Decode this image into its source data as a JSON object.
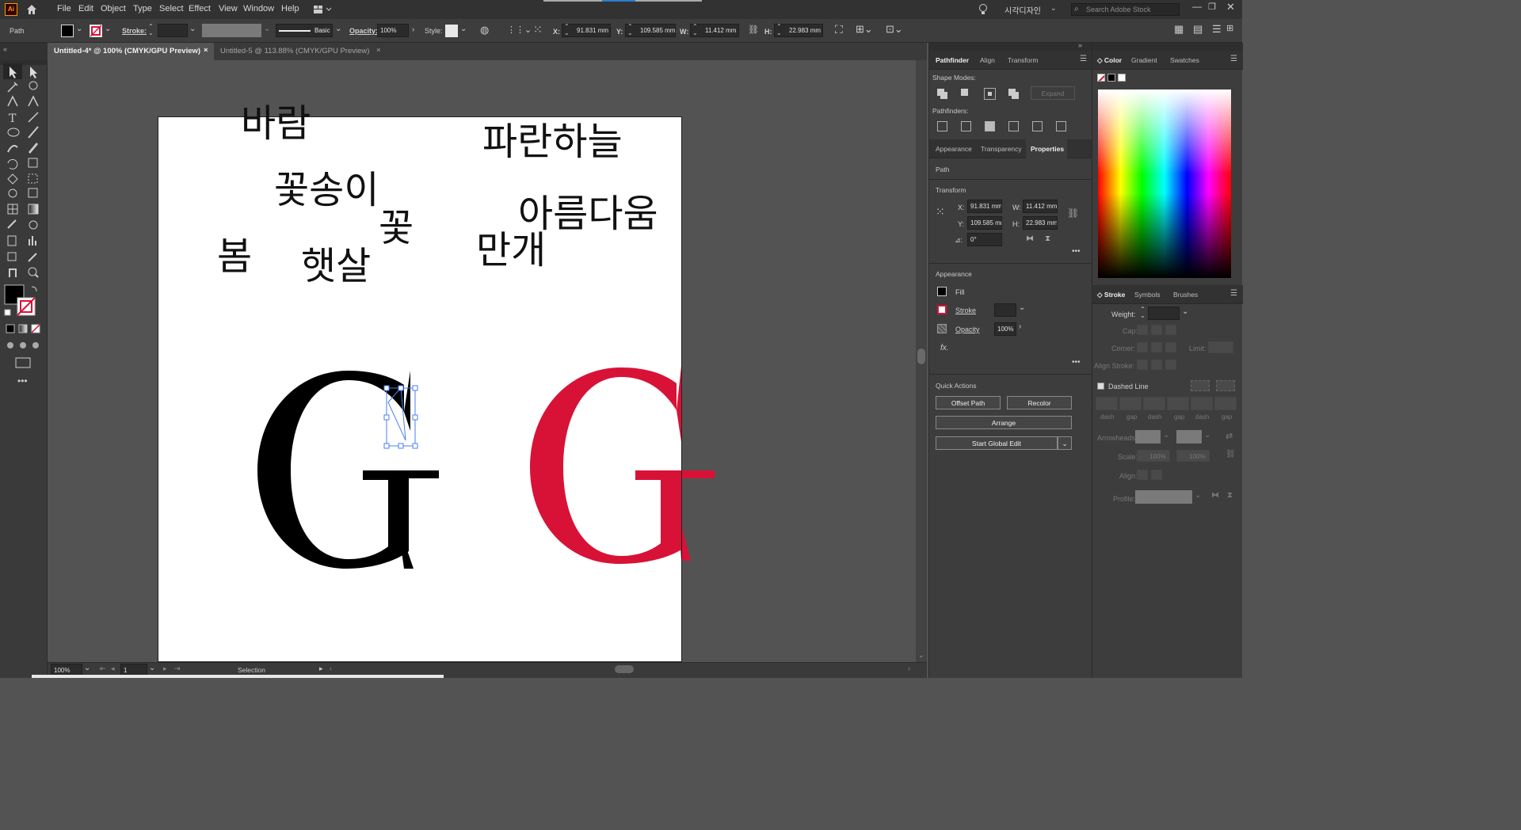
{
  "app": {
    "logo": "Ai"
  },
  "menu": [
    "File",
    "Edit",
    "Object",
    "Type",
    "Select",
    "Effect",
    "View",
    "Window",
    "Help"
  ],
  "menu_right": {
    "workspace": "시각디자인",
    "search_placeholder": "Search Adobe Stock"
  },
  "control": {
    "selection_type": "Path",
    "stroke_label": "Stroke:",
    "stroke_style": "Basic",
    "opacity_label": "Opacity:",
    "opacity_value": "100%",
    "style_label": "Style:",
    "x_label": "X:",
    "x_value": "91.831 mm",
    "y_label": "Y:",
    "y_value": "109.585 mm",
    "w_label": "W:",
    "w_value": "11.412 mm",
    "h_label": "H:",
    "h_value": "22.983 mm"
  },
  "tabs": [
    {
      "label": "Untitled-4* @ 100% (CMYK/GPU Preview)",
      "close": "×"
    },
    {
      "label": "Untitled-5 @ 113.88% (CMYK/GPU Preview)",
      "close": "×"
    }
  ],
  "artboard_text": [
    "바람",
    "파란하늘",
    "꽃송이",
    "꽃",
    "아름다움",
    "봄",
    "햇살",
    "만개"
  ],
  "glyph": {
    "letter": "G",
    "black": "#000000",
    "red": "#d81237"
  },
  "status": {
    "zoom": "100%",
    "artboard": "1",
    "tool": "Selection"
  },
  "pathfinder": {
    "tabs": [
      "Pathfinder",
      "Align",
      "Transform"
    ],
    "shape_modes": "Shape Modes:",
    "expand": "Expand",
    "pathfinders": "Pathfinders:"
  },
  "properties": {
    "tabs": [
      "Appearance",
      "Transparency",
      "Properties"
    ],
    "selection": "Path",
    "transform_title": "Transform",
    "x_label": "X:",
    "x": "91.831 mm",
    "y_label": "Y:",
    "y": "109.585 mr",
    "w_label": "W:",
    "w": "11.412 mm",
    "h_label": "H:",
    "h": "22.983 mm",
    "angle_label": "⊿:",
    "angle": "0°",
    "appearance_title": "Appearance",
    "fill": "Fill",
    "stroke": "Stroke",
    "opacity": "Opacity",
    "opacity_value": "100%",
    "fx": "fx.",
    "quick_actions": "Quick Actions",
    "offset_path": "Offset Path",
    "recolor": "Recolor",
    "arrange": "Arrange",
    "global_edit": "Start Global Edit"
  },
  "color_panel": {
    "tabs": [
      "Color",
      "Gradient",
      "Swatches"
    ]
  },
  "stroke_panel": {
    "tabs": [
      "Stroke",
      "Symbols",
      "Brushes"
    ],
    "weight": "Weight:",
    "cap": "Cap:",
    "corner": "Corner:",
    "limit": "Limit:",
    "align_stroke": "Align Stroke:",
    "dashed_line": "Dashed Line",
    "dash_labels": [
      "dash",
      "gap",
      "dash",
      "gap",
      "dash",
      "gap"
    ],
    "arrowheads": "Arrowheads:",
    "scale": "Scale:",
    "scale_values": [
      "100%",
      "100%"
    ],
    "align": "Align:",
    "profile": "Profile:"
  }
}
